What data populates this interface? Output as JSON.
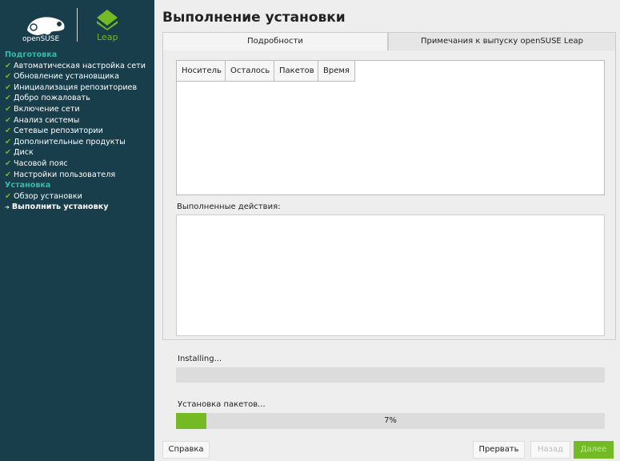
{
  "sidebar": {
    "logo_text": "openSUSE",
    "leap_text": "Leap",
    "sections": [
      {
        "title": "Подготовка",
        "items": [
          "Автоматическая настройка сети",
          "Обновление установщика",
          "Инициализация репозиториев",
          "Добро пожаловать",
          "Включение сети",
          "Анализ системы",
          "Сетевые репозитории",
          "Дополнительные продукты",
          "Диск",
          "Часовой пояс",
          "Настройки пользователя"
        ]
      },
      {
        "title": "Установка",
        "items": [
          "Обзор установки"
        ],
        "current": "Выполнить установку"
      }
    ],
    "check_icon": "✔",
    "arrow_icon": "➔"
  },
  "title": "Выполнение установки",
  "tabs": [
    "Подробности",
    "Примечания к выпуску openSUSE Leap"
  ],
  "table": {
    "columns": [
      "Носитель",
      "Осталось",
      "Пакетов",
      "Время"
    ]
  },
  "actions_label": "Выполненные действия:",
  "progress1": {
    "label": "Installing...",
    "value": 0
  },
  "progress2": {
    "label": "Установка пакетов...",
    "value": 7,
    "text": "7%"
  },
  "buttons": {
    "help": "Справка",
    "abort": "Прервать",
    "back": "Назад",
    "next": "Далее"
  },
  "colors": {
    "accent": "#73ba25",
    "sidebar": "#183e4c",
    "section": "#35b9ab"
  }
}
